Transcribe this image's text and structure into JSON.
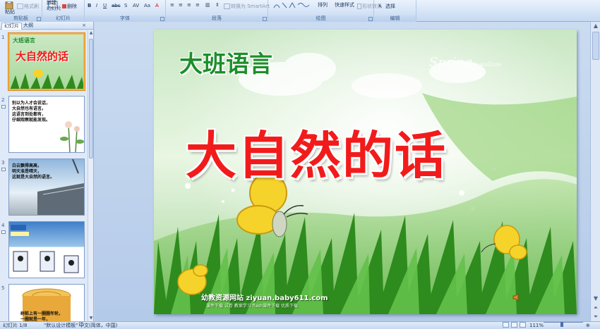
{
  "ribbon": {
    "groups": [
      {
        "label": "剪贴板"
      },
      {
        "label": "幻灯片"
      },
      {
        "label": "字体"
      },
      {
        "label": "段落"
      },
      {
        "label": "绘图"
      },
      {
        "label": "编辑"
      }
    ],
    "paste_label": "粘贴",
    "format_painter_label": "格式刷",
    "new_slide_label": "新建\n幻灯片",
    "delete_label": "删除",
    "convert_smartart_label": "转换为 SmartArt",
    "arrange_label": "排列",
    "quick_styles_label": "快速样式",
    "shape_effects_label": "形状效果",
    "select_label": "选择"
  },
  "panel": {
    "tab_slides": "幻灯片",
    "tab_outline": "大纲",
    "close_glyph": "×",
    "slides": [
      {
        "number": "1",
        "title": "大班语言",
        "headline": "大自然的话"
      },
      {
        "number": "2",
        "lines": "别以为人才会说话，\n大自然也有语言。\n这语言到处都有，\n仔细观察就能发现。"
      },
      {
        "number": "3",
        "lines": "白云飘得高高，\n明天准是晴天，\n这就是大自然的语言。"
      },
      {
        "number": "4"
      },
      {
        "number": "5",
        "lines": "树桩上有一圈圈年轮，\n一圈就是一年，\n这就是大自然的语言。"
      }
    ]
  },
  "slide": {
    "subtitle": "大班语言",
    "title": "大自然的话",
    "spring_text": "Spring",
    "spring_small": "in wallcoo",
    "watermark": "幼教资源网站 ziyuan.baby611.com",
    "watermark_sub": "课件下载  试卷  教案学习  flash课件下载  优质下载",
    "colors": {
      "title": "#f21b1b",
      "subtitle": "#1d8e2a",
      "grass": "#2e8b1e"
    }
  },
  "status": {
    "slide_counter": "幻灯片 1/8",
    "theme": "\"默认设计模板\"",
    "language": "中文(简体，中国)",
    "zoom": "111%"
  }
}
